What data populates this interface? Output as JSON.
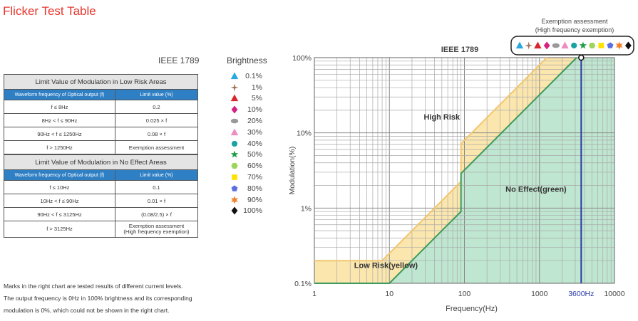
{
  "page": {
    "title": "Flicker Test Table",
    "ieee_label": "IEEE 1789",
    "brightness_title": "Brightness",
    "notes": [
      "Marks in the right chart are tested results of different current levels.",
      "The output frequency is 0Hz in 100% brightness and its corresponding",
      "modulation is 0%, which could not be shown in the right chart."
    ]
  },
  "tables": {
    "low_risk": {
      "caption": "Limit Value of Modulation in Low Risk Areas",
      "headers": [
        "Waveform frequency of Optical output (f)",
        "Limit value (%)"
      ],
      "rows": [
        [
          "f ≤ 8Hz",
          "0.2"
        ],
        [
          "8Hz < f ≤ 90Hz",
          "0.025 × f"
        ],
        [
          "90Hz < f ≤ 1250Hz",
          "0.08 × f"
        ],
        [
          "f > 1250Hz",
          "Exemption assessment"
        ]
      ]
    },
    "no_effect": {
      "caption": "Limit Value of Modulation in No Effect Areas",
      "headers": [
        "Waveform frequency of Optical output (f)",
        "Limit value (%)"
      ],
      "rows": [
        [
          "f ≤ 10Hz",
          "0.1"
        ],
        [
          "10Hz < f ≤ 90Hz",
          "0.01 × f"
        ],
        [
          "90Hz < f ≤ 3125Hz",
          "(0.08/2.5) × f"
        ],
        [
          "f > 3125Hz",
          "Exemption assessment\n(High frequency exemption)"
        ]
      ]
    }
  },
  "brightness_legend": [
    {
      "label": "0.1%",
      "marker": "triangle",
      "color": "#29a8e0"
    },
    {
      "label": "1%",
      "marker": "star4",
      "color": "#a0785a"
    },
    {
      "label": "5%",
      "marker": "triangle",
      "color": "#d9262c"
    },
    {
      "label": "10%",
      "marker": "diamond",
      "color": "#d6217f"
    },
    {
      "label": "20%",
      "marker": "ellipse",
      "color": "#999999"
    },
    {
      "label": "30%",
      "marker": "triangle",
      "color": "#f08cbf"
    },
    {
      "label": "40%",
      "marker": "circle",
      "color": "#1aa3a3"
    },
    {
      "label": "50%",
      "marker": "star5",
      "color": "#1e9e4a"
    },
    {
      "label": "60%",
      "marker": "hexagon",
      "color": "#9dd45a"
    },
    {
      "label": "70%",
      "marker": "square",
      "color": "#ffe100"
    },
    {
      "label": "80%",
      "marker": "pentagon",
      "color": "#5d6fe0"
    },
    {
      "label": "90%",
      "marker": "star6",
      "color": "#f5822a"
    },
    {
      "label": "100%",
      "marker": "diamond",
      "color": "#111111"
    }
  ],
  "chart_data": {
    "type": "area",
    "title": "IEEE 1789",
    "xlabel": "Frequency(Hz)",
    "ylabel": "Modulation(%)",
    "x_scale": "log",
    "y_scale": "log",
    "xlim": [
      1,
      10000
    ],
    "ylim": [
      0.1,
      100
    ],
    "x_ticks": [
      {
        "value": 1,
        "label": "1"
      },
      {
        "value": 10,
        "label": "10"
      },
      {
        "value": 100,
        "label": "100"
      },
      {
        "value": 1000,
        "label": "1000"
      },
      {
        "value": 3600,
        "label": "3600Hz"
      },
      {
        "value": 10000,
        "label": "10000"
      }
    ],
    "y_ticks": [
      {
        "value": 0.1,
        "label": "0.1%"
      },
      {
        "value": 1,
        "label": "1%"
      },
      {
        "value": 10,
        "label": "10%"
      },
      {
        "value": 100,
        "label": "100%"
      }
    ],
    "grid": true,
    "series": [
      {
        "name": "Low Risk(yellow)",
        "color": "#fbe6ae",
        "edge": "#f3c66f",
        "boundary": [
          [
            1,
            0.2
          ],
          [
            8,
            0.2
          ],
          [
            90,
            2.25
          ],
          [
            90,
            7.2
          ],
          [
            1250,
            100
          ]
        ]
      },
      {
        "name": "No Effect(green)",
        "color": "#bfe6d0",
        "edge": "#3d9a5a",
        "boundary": [
          [
            1,
            0.1
          ],
          [
            10,
            0.1
          ],
          [
            90,
            0.9
          ],
          [
            90,
            2.88
          ],
          [
            3125,
            100
          ]
        ]
      }
    ],
    "area_labels": [
      {
        "text": "High Risk",
        "x": 50,
        "y": 15
      },
      {
        "text": "No Effect(green)",
        "x": 900,
        "y": 1.65
      },
      {
        "text": "Low Risk(yellow)",
        "x": 9,
        "y": 0.16
      }
    ],
    "reference_line": {
      "x": 3600,
      "color": "#2b3aa8"
    },
    "measured_point": {
      "x": 3600,
      "y": 100,
      "label": "Exemption assessment\n(High frequency exemption)"
    }
  }
}
